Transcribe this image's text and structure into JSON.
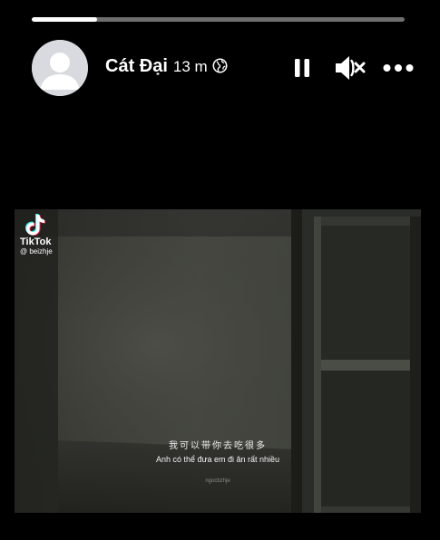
{
  "story": {
    "progress": 0.175,
    "progress_color": "#ffffff",
    "track_color": "#6e6e6e"
  },
  "header": {
    "author_name": "Cát Đại",
    "timestamp": "13 m",
    "privacy_icon": "globe-icon",
    "avatar_icon": "default-avatar-icon"
  },
  "controls": {
    "pause_icon": "pause-icon",
    "mute_icon": "muted-speaker-icon",
    "more_icon": "more-horizontal-icon"
  },
  "video": {
    "watermark_brand": "TikTok",
    "watermark_handle": "@ beizhje",
    "subtitle_chinese": "我可以带你去吃很多",
    "subtitle_vietnamese": "Anh có thể đưa em đi ăn rất nhiều",
    "bottom_watermark": "ngocbzhje"
  }
}
